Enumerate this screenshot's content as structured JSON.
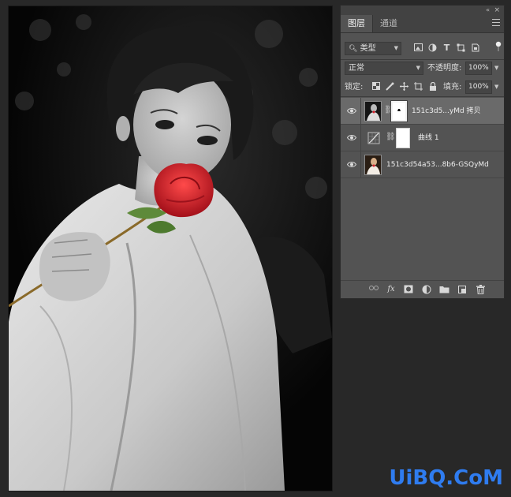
{
  "panel": {
    "tabs": [
      {
        "label": "图层",
        "active": true
      },
      {
        "label": "通道",
        "active": false
      }
    ],
    "collapse_glyph": "«",
    "close_glyph": "×",
    "filter": {
      "kind_label": "类型",
      "icons": [
        "image-filter-icon",
        "adjustment-filter-icon",
        "type-filter-icon",
        "shape-filter-icon",
        "smart-object-filter-icon",
        "filter-toggle-icon"
      ]
    },
    "blend": {
      "mode": "正常",
      "opacity_label": "不透明度:",
      "opacity_value": "100%"
    },
    "lock": {
      "label": "锁定:",
      "fill_label": "填充:",
      "fill_value": "100%"
    },
    "layers": [
      {
        "name": "151c3d5...yMd 拷贝",
        "visible": true,
        "selected": true,
        "has_mask": true,
        "type": "pixel"
      },
      {
        "name": "曲线 1",
        "visible": true,
        "selected": false,
        "has_mask": true,
        "type": "adjustment-curves"
      },
      {
        "name": "151c3d54a53...8b6-GSQyMd",
        "visible": true,
        "selected": false,
        "has_mask": false,
        "type": "pixel"
      }
    ],
    "bottom_icons": [
      "link-layers-icon",
      "fx-icon",
      "add-mask-icon",
      "new-adjustment-icon",
      "new-group-icon",
      "new-layer-icon",
      "delete-layer-icon"
    ],
    "fx_label": "fx"
  },
  "colors": {
    "rose": "#d81e2a",
    "panel_bg": "#535353",
    "selected_row": "#6a6a6a",
    "watermark": "#2f7cf0"
  },
  "watermark": "UiBQ.CoM"
}
